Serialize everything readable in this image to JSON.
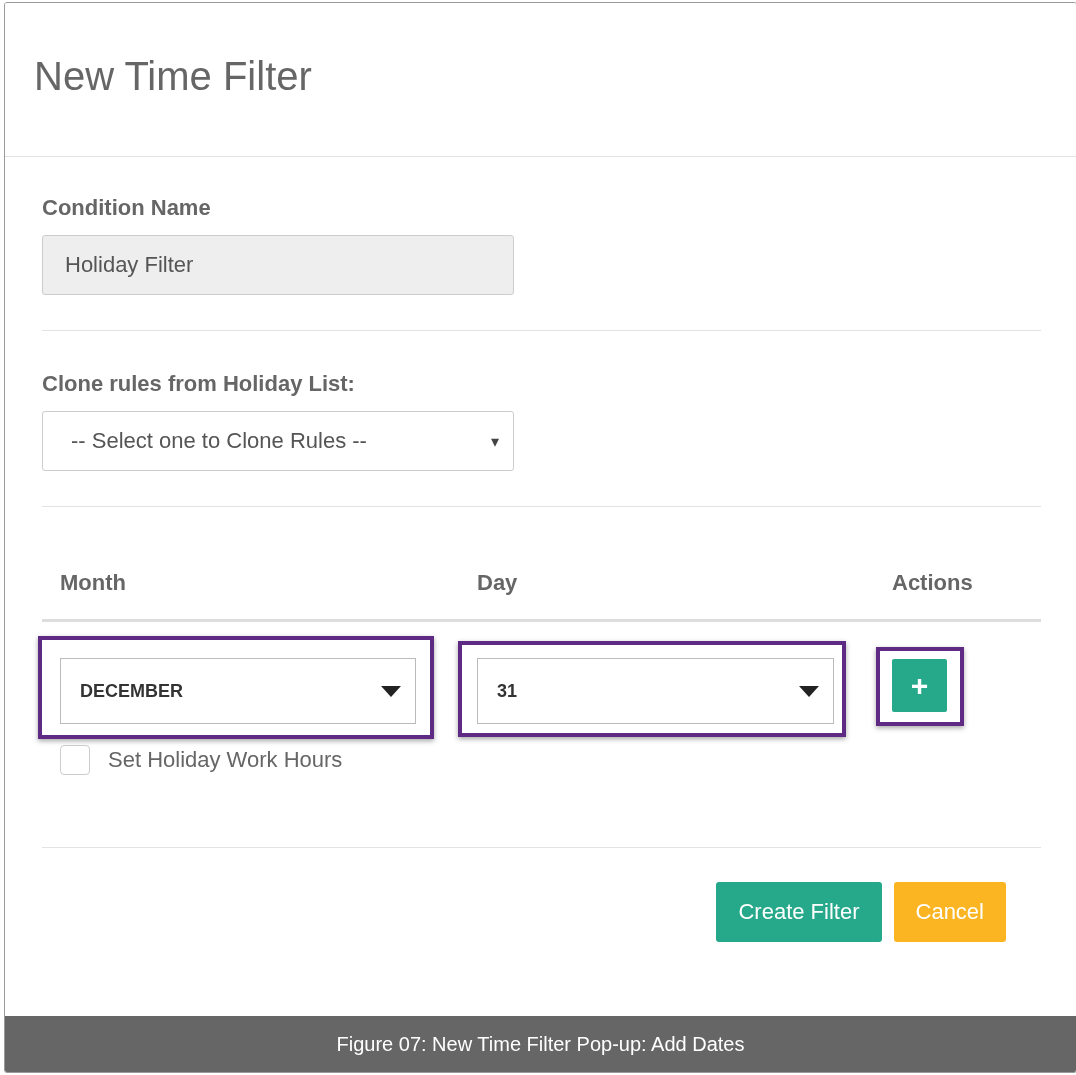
{
  "dialog": {
    "title": "New Time Filter"
  },
  "condition_name": {
    "label": "Condition Name",
    "value": "Holiday Filter",
    "disabled": true
  },
  "clone_rules": {
    "label": "Clone rules from Holiday List:",
    "value": "-- Select one to Clone Rules --",
    "caret": "▾"
  },
  "table": {
    "columns": [
      "Month",
      "Day",
      "Actions"
    ],
    "row": {
      "month": {
        "value": "DECEMBER",
        "highlighted": true
      },
      "day": {
        "value": "31",
        "highlighted": true
      },
      "add_button": {
        "label": "+",
        "highlighted": true
      },
      "holiday_hours": {
        "label": "Set Holiday Work Hours",
        "checked": false
      }
    }
  },
  "buttons": [
    {
      "label": "Create Filter",
      "kind": "primary"
    },
    {
      "label": "Cancel",
      "kind": "warning"
    }
  ],
  "caption": "Figure 07: New Time Filter Pop-up: Add Dates"
}
